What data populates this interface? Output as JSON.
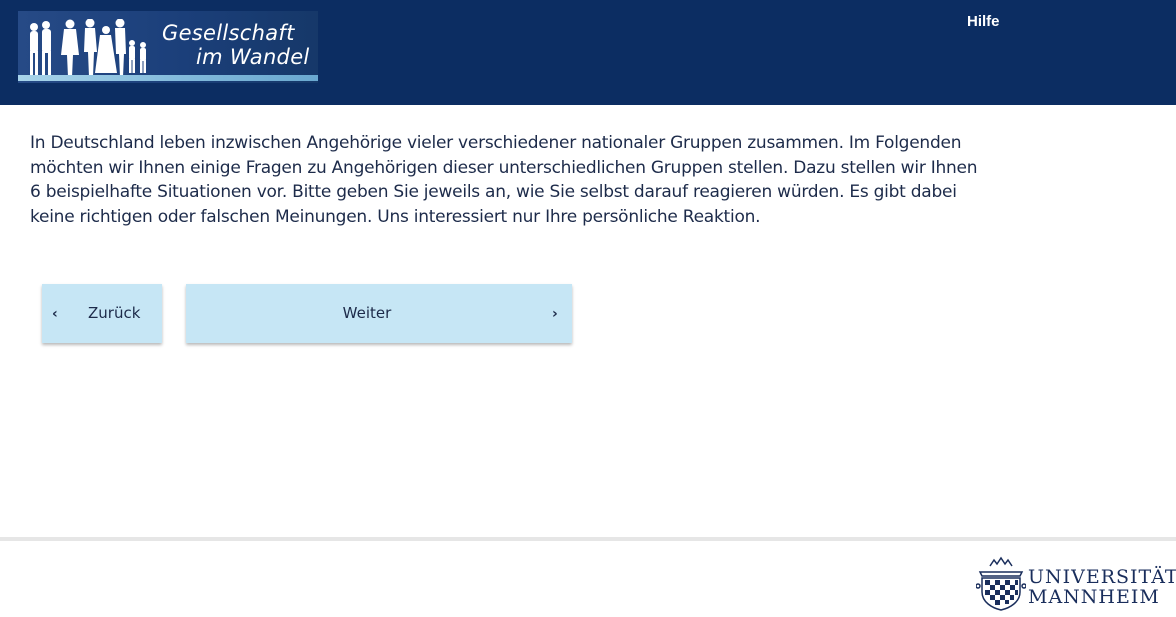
{
  "header": {
    "logo": {
      "line1": "Gesellschaft",
      "line2": "im Wandel"
    },
    "help_link": "Hilfe"
  },
  "main": {
    "intro_text": "In Deutschland leben inzwischen Angehörige vieler verschiedener nationaler Gruppen zusammen. Im Folgenden möchten wir Ihnen einige Fragen zu Angehörigen dieser unterschiedlichen Gruppen stellen. Dazu stellen wir Ihnen 6 beispielhafte Situationen vor. Bitte geben Sie jeweils an, wie Sie selbst darauf reagieren würden. Es gibt dabei keine richtigen oder falschen Meinungen. Uns interessiert nur Ihre persönliche Reaktion."
  },
  "navigation": {
    "back_label": "Zurück",
    "next_label": "Weiter",
    "back_icon": "chevron-left-icon",
    "next_icon": "chevron-right-icon"
  },
  "footer": {
    "university": {
      "line1": "UNIVERSITÄT",
      "line2": "MANNHEIM"
    }
  },
  "colors": {
    "header_bg": "#0c2d62",
    "button_bg": "#c6e6f5",
    "text": "#1d2b4a"
  }
}
